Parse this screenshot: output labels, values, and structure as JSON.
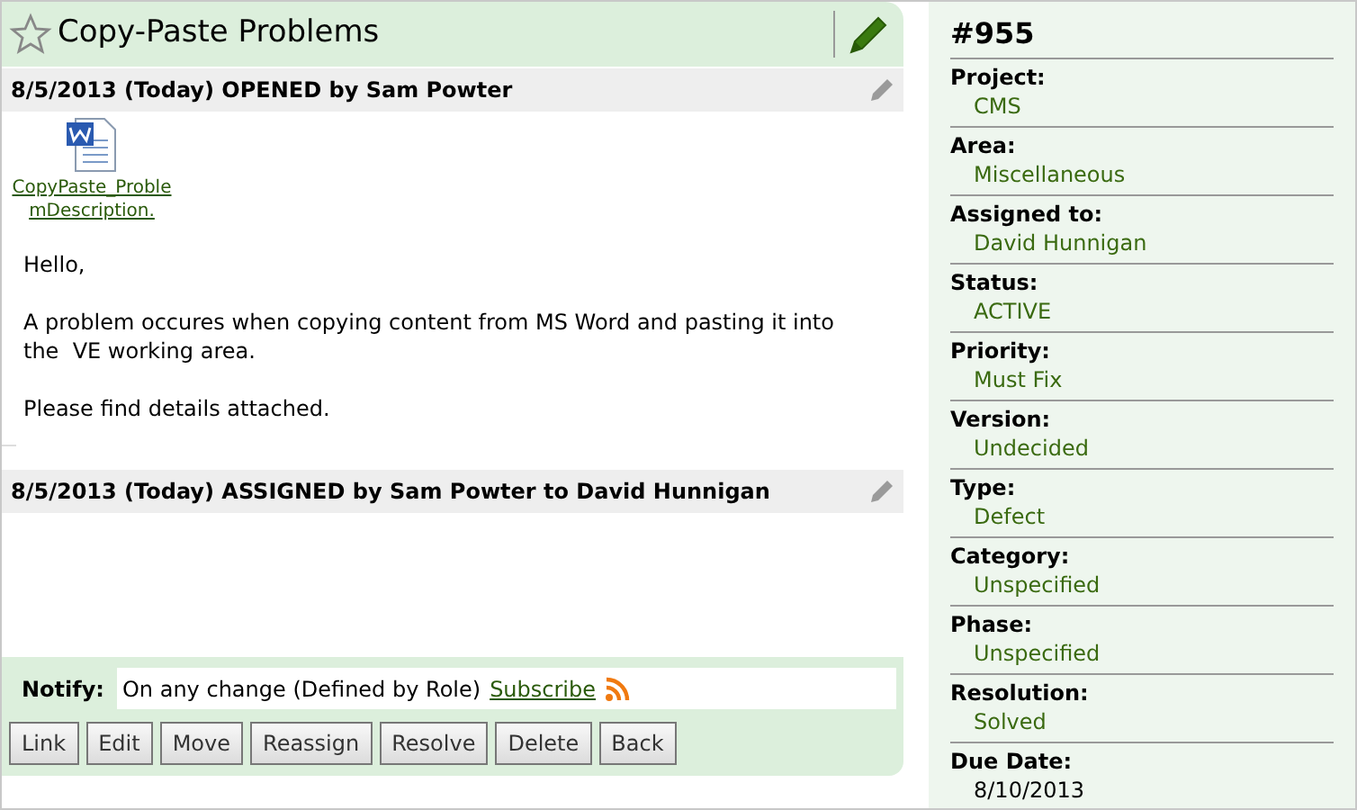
{
  "issue": {
    "title": "Copy-Paste Problems",
    "starred": false
  },
  "events": [
    {
      "header": "8/5/2013 (Today) OPENED by Sam Powter",
      "attachment": {
        "name": "CopyPaste_ProblemDescription."
      },
      "paragraphs": [
        "Hello,",
        "A problem occures when copying content from MS Word and pasting it into the  VE working area.",
        "Please find details attached."
      ]
    },
    {
      "header": "8/5/2013 (Today) ASSIGNED by Sam Powter to David Hunnigan"
    }
  ],
  "notify": {
    "label": "Notify:",
    "text": "On any change (Defined by Role)",
    "link": "Subscribe"
  },
  "buttons": [
    "Link",
    "Edit",
    "Move",
    "Reassign",
    "Resolve",
    "Delete",
    "Back"
  ],
  "details": {
    "number": "#955",
    "fields": [
      {
        "label": "Project:",
        "value": "CMS",
        "linked": true
      },
      {
        "label": "Area:",
        "value": "Miscellaneous",
        "linked": true
      },
      {
        "label": "Assigned to:",
        "value": "David Hunnigan",
        "linked": true
      },
      {
        "label": "Status:",
        "value": "ACTIVE",
        "linked": true
      },
      {
        "label": "Priority:",
        "value": "Must Fix",
        "linked": true
      },
      {
        "label": "Version:",
        "value": "Undecided",
        "linked": true
      },
      {
        "label": "Type:",
        "value": "Defect",
        "linked": true
      },
      {
        "label": "Category:",
        "value": "Unspecified",
        "linked": true
      },
      {
        "label": "Phase:",
        "value": "Unspecified",
        "linked": true
      },
      {
        "label": "Resolution:",
        "value": "Solved",
        "linked": true
      },
      {
        "label": "Due Date:",
        "value": "8/10/2013",
        "linked": false
      }
    ]
  }
}
